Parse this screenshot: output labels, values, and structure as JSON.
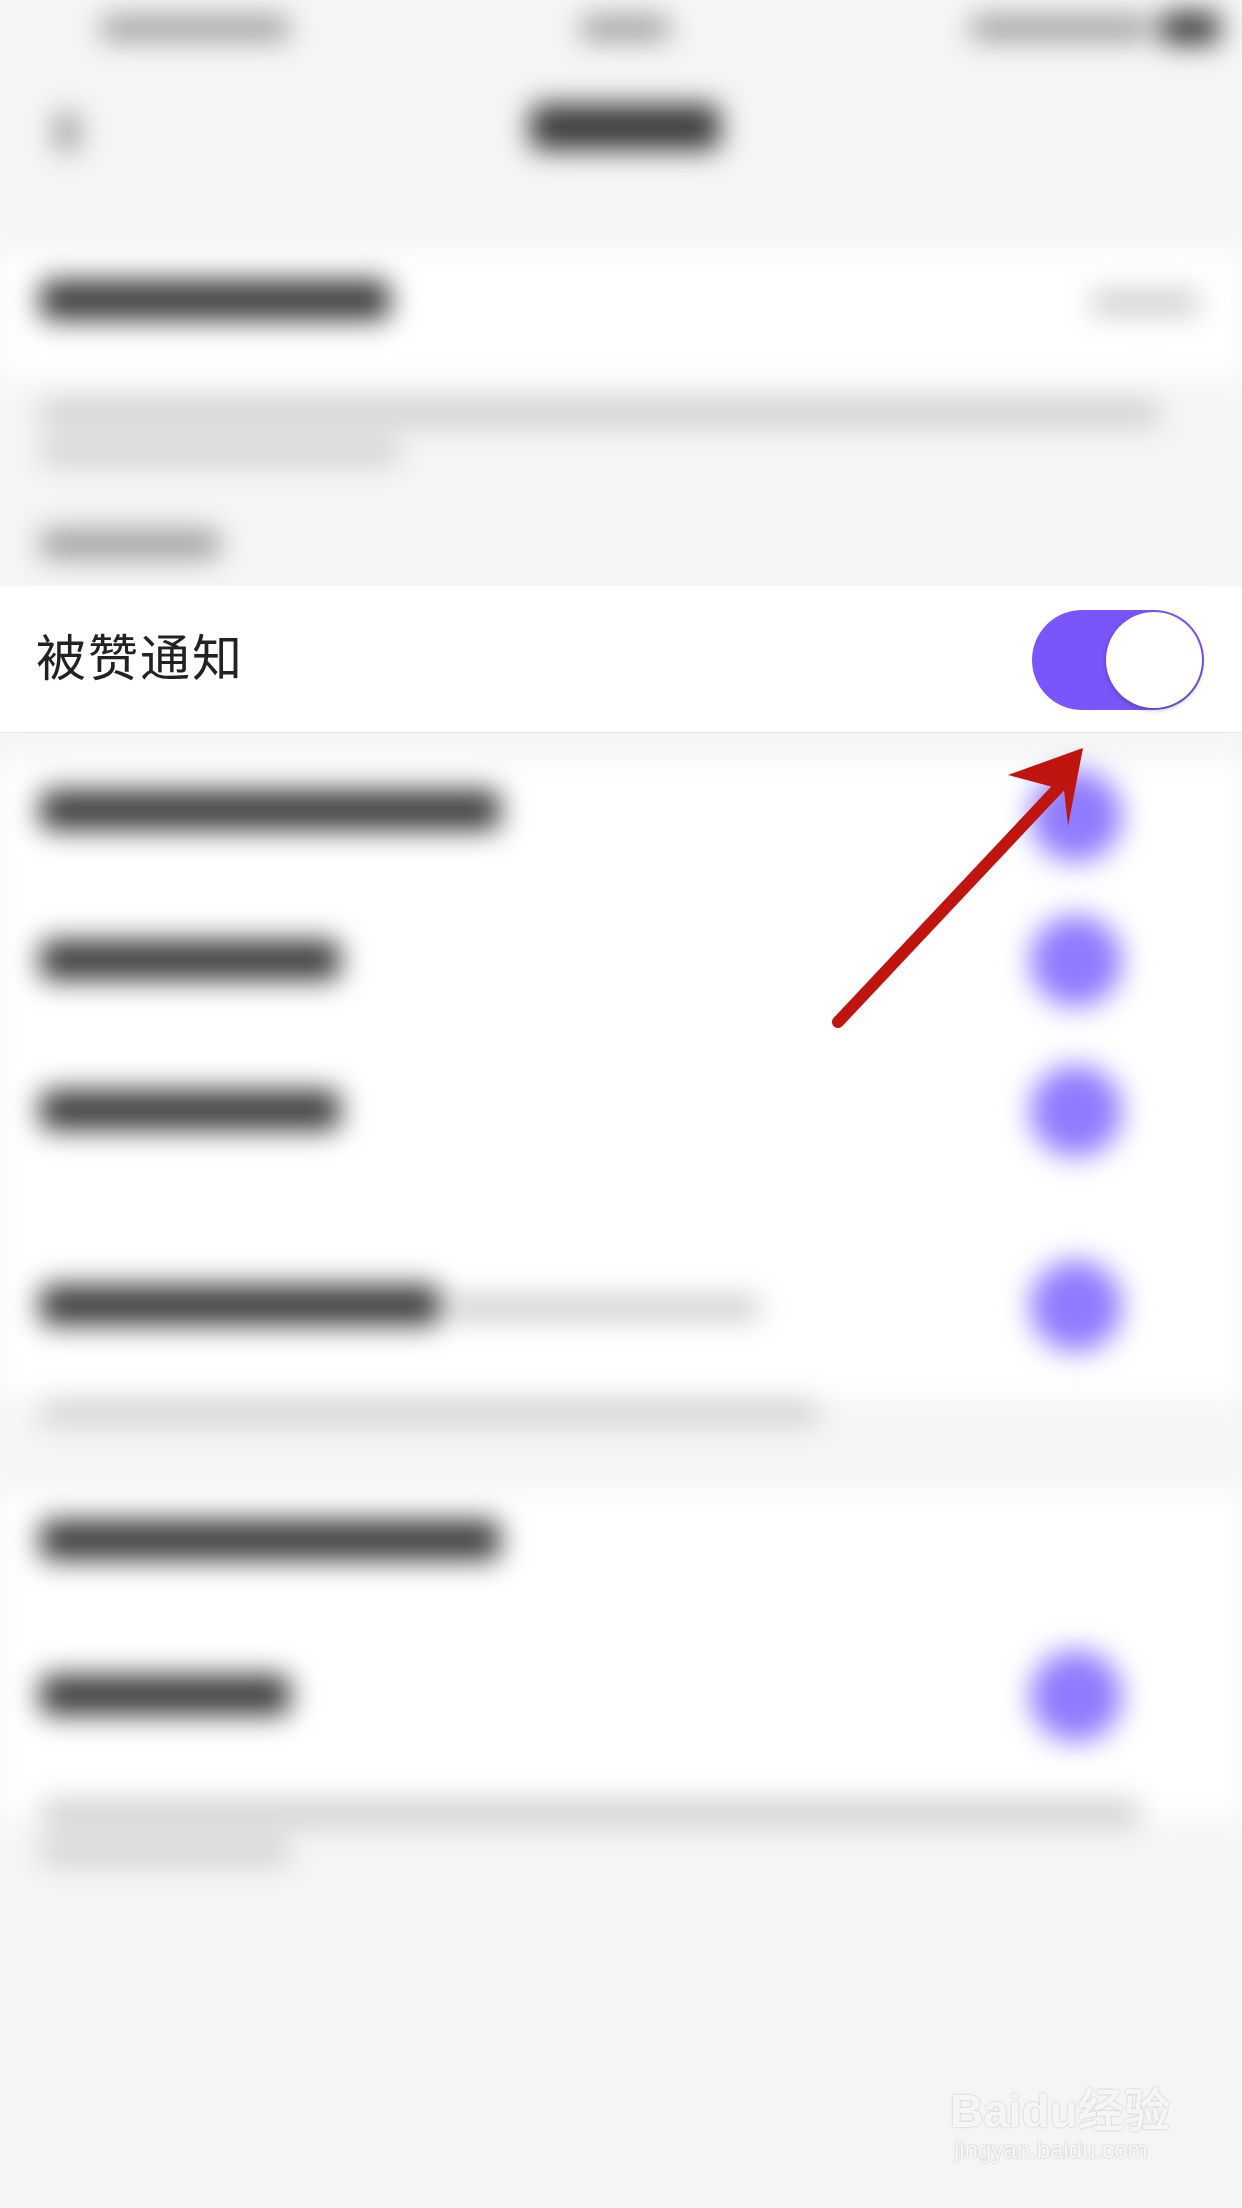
{
  "setting_row": {
    "label": "被赞通知",
    "toggle_on": true
  },
  "colors": {
    "toggle_on": "#7a55fc",
    "arrow": "#c0140f",
    "blur_dots": "#8f7bff"
  },
  "watermark": {
    "brand": "Baidu经验",
    "url": "jingyan.baidu.com"
  }
}
